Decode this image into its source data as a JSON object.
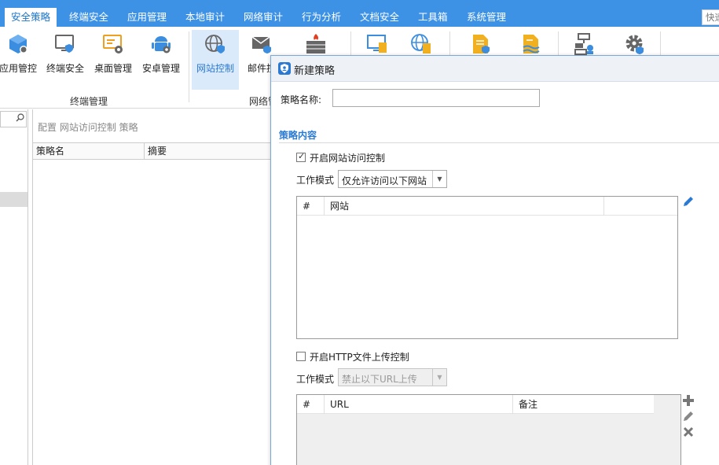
{
  "menu": {
    "items": [
      "安全策略",
      "终端安全",
      "应用管理",
      "本地审计",
      "网络审计",
      "行为分析",
      "文档安全",
      "工具箱",
      "系统管理"
    ],
    "active_index": 0,
    "quick_search": "快速"
  },
  "ribbon": {
    "buttons": [
      "应用管控",
      "终端安全",
      "桌面管理",
      "安卓管理",
      "网站控制",
      "邮件控"
    ],
    "selected_button": "网站控制",
    "groups": [
      "终端管理",
      "网络管"
    ]
  },
  "main": {
    "breadcrumb": "配置 网站访问控制 策略",
    "columns": [
      "策略名",
      "摘要"
    ]
  },
  "dialog": {
    "title": "新建策略",
    "name_label": "策略名称:",
    "name_value": "",
    "section_title": "策略内容",
    "website_control": {
      "checkbox_label": "开启网站访问控制",
      "checked": true,
      "mode_label": "工作模式",
      "mode_value": "仅允许访问以下网站",
      "columns": [
        "#",
        "网站"
      ]
    },
    "http_upload": {
      "checkbox_label": "开启HTTP文件上传控制",
      "checked": false,
      "mode_label": "工作模式",
      "mode_value": "禁止以下URL上传",
      "columns": [
        "#",
        "URL",
        "备注"
      ]
    }
  },
  "colors": {
    "menubar": "#3d92e5",
    "accent": "#2a7ad3",
    "selected_ribbon": "#dbeafb"
  }
}
